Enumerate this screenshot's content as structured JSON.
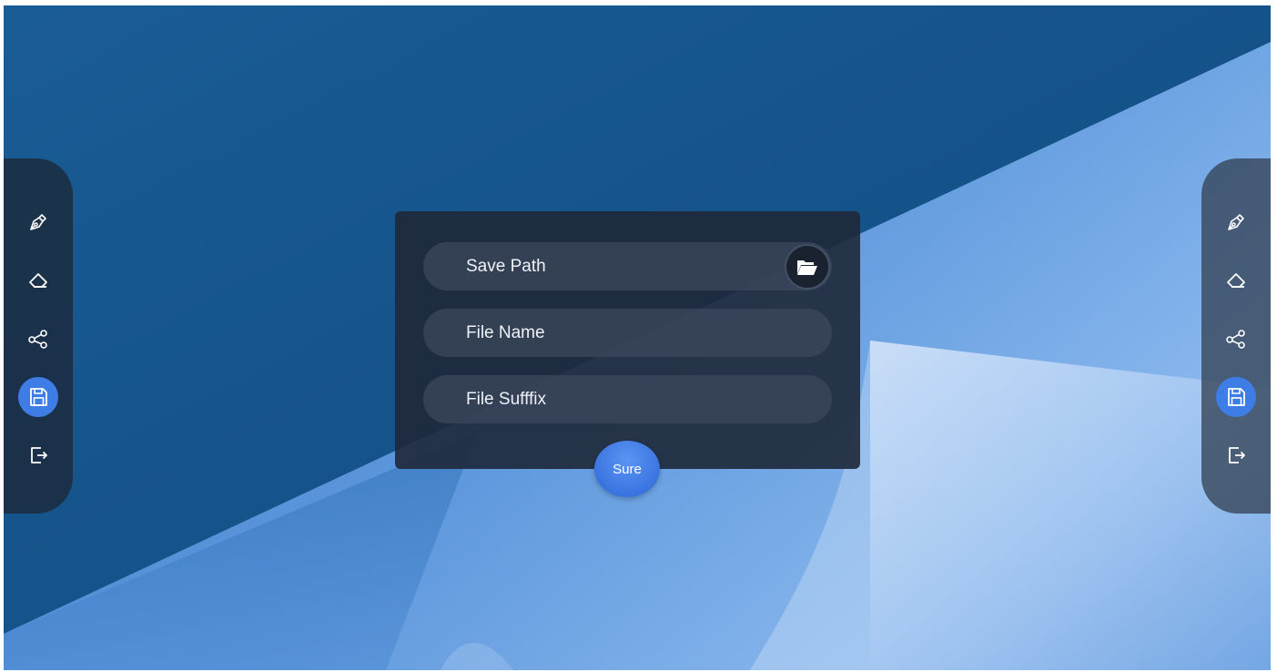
{
  "dialog": {
    "fields": [
      {
        "placeholder": "Save Path"
      },
      {
        "placeholder": "File Name"
      },
      {
        "placeholder": "File Sufffix"
      }
    ],
    "confirm_label": "Sure"
  },
  "toolbar": {
    "tools": [
      {
        "icon": "pen-icon"
      },
      {
        "icon": "eraser-icon"
      },
      {
        "icon": "share-icon"
      },
      {
        "icon": "save-icon",
        "active": true
      },
      {
        "icon": "exit-icon"
      }
    ],
    "active_color": "#3f7de6"
  },
  "theme": {
    "background": "#14558a",
    "accent": "#3f7de6"
  }
}
